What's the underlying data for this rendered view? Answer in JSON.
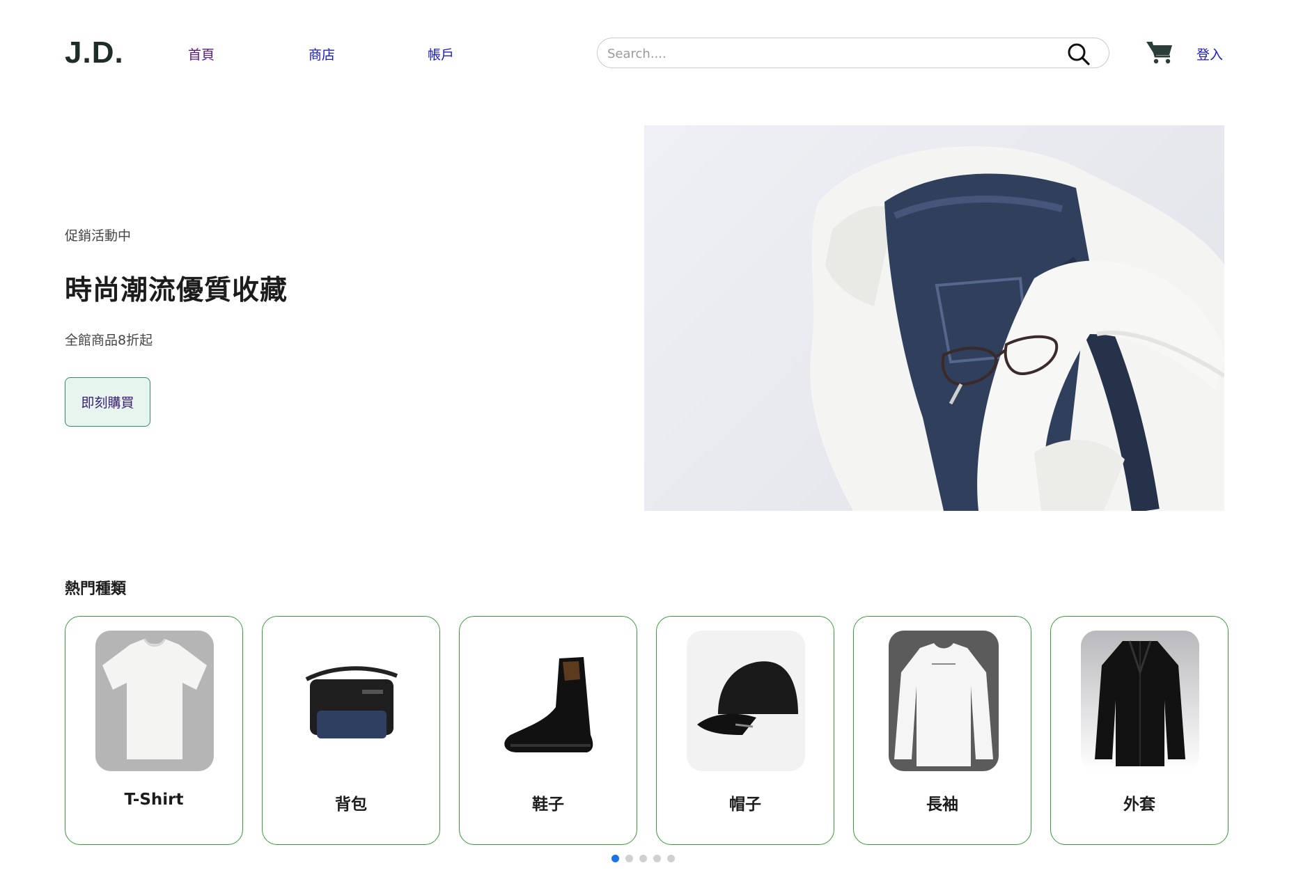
{
  "header": {
    "logo": "J.D.",
    "nav": [
      {
        "label": "首頁"
      },
      {
        "label": "商店"
      },
      {
        "label": "帳戶"
      }
    ],
    "search": {
      "placeholder": "Search...."
    },
    "login_label": "登入",
    "icons": [
      "search-icon",
      "cart-icon"
    ]
  },
  "hero": {
    "kicker": "促銷活動中",
    "title": "時尚潮流優質收藏",
    "subtitle": "全館商品8折起",
    "cta_label": "即刻購買"
  },
  "categories": {
    "title": "熱門種類",
    "items": [
      {
        "label": "T-Shirt"
      },
      {
        "label": "背包"
      },
      {
        "label": "鞋子"
      },
      {
        "label": "帽子"
      },
      {
        "label": "長袖"
      },
      {
        "label": "外套"
      }
    ],
    "pagination": {
      "pages": 5,
      "active": 1
    }
  },
  "colors": {
    "accent": "#1a73e8",
    "card_border": "#3a9a3a",
    "button_bg": "#e8f5ee",
    "button_border": "#2f8a66",
    "link": "#1a1ac8"
  }
}
